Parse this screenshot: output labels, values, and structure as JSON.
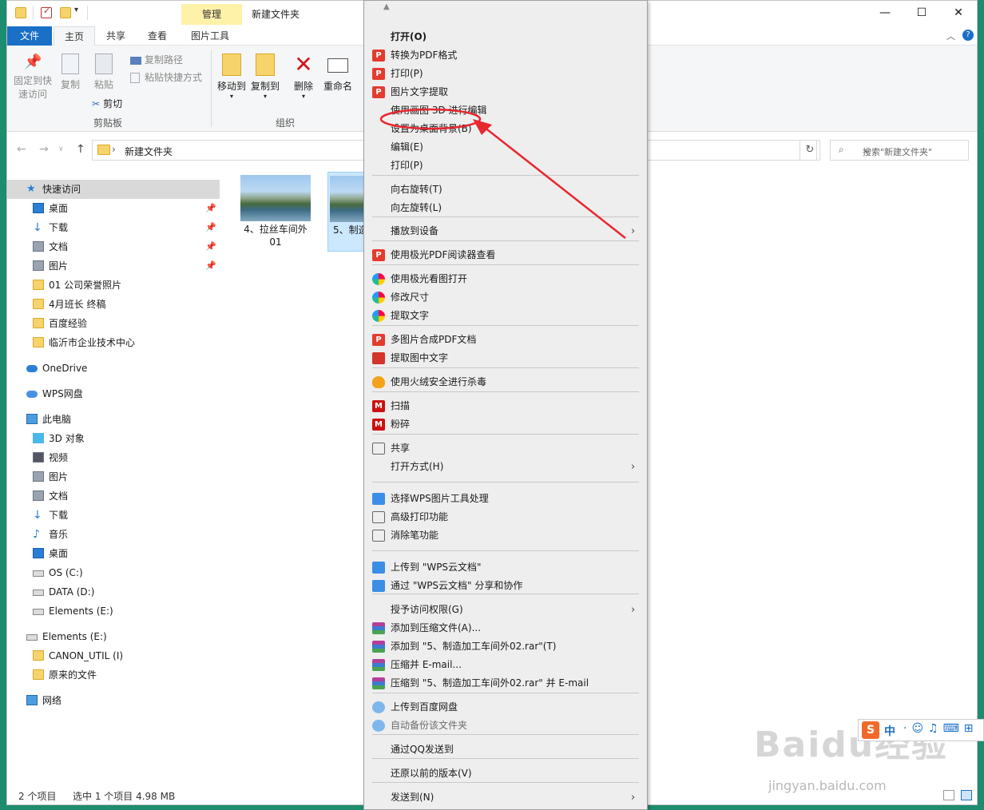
{
  "window": {
    "title": "新建文件夹",
    "contextual_tab": "管理",
    "controls": {
      "minimize": "—",
      "maximize": "☐",
      "close": "✕"
    }
  },
  "ribbon_tabs": [
    "文件",
    "主页",
    "共享",
    "查看",
    "图片工具"
  ],
  "ribbon": {
    "pin_quick": "固定到快速访问",
    "copy": "复制",
    "paste": "粘贴",
    "copy_path": "复制路径",
    "paste_shortcut": "粘贴快捷方式",
    "cut": "剪切",
    "group_clipboard": "剪贴板",
    "move_to": "移动到",
    "copy_to": "复制到",
    "delete": "删除",
    "rename": "重命名",
    "group_organize": "组织"
  },
  "address": {
    "path": "新建文件夹",
    "search_placeholder": "搜索\"新建文件夹\""
  },
  "nav": {
    "quick_access": "快速访问",
    "quick_items": [
      "桌面",
      "下载",
      "文档",
      "图片",
      "01 公司荣誉照片",
      "4月班长  终稿",
      "百度经验",
      "临沂市企业技术中心"
    ],
    "onedrive": "OneDrive",
    "wps_drive": "WPS网盘",
    "this_pc": "此电脑",
    "pc_items": [
      "3D 对象",
      "视频",
      "图片",
      "文档",
      "下载",
      "音乐",
      "桌面",
      "OS (C:)",
      "DATA (D:)",
      "Elements (E:)"
    ],
    "elements": "Elements (E:)",
    "elements_items": [
      "CANON_UTIL (I)",
      "原来的文件"
    ],
    "network": "网络"
  },
  "files": [
    {
      "caption_line1": "4、拉丝车间外",
      "caption_line2": "01"
    },
    {
      "caption_line1": "5、制造",
      "caption_line2": "外"
    }
  ],
  "status": {
    "count": "2 个项目",
    "selection": "选中 1 个项目  4.98 MB"
  },
  "context_menu": {
    "scroll_up": "▲",
    "items": [
      {
        "label": "打开(O)"
      },
      {
        "label": "转换为PDF格式"
      },
      {
        "label": "打印(P)"
      },
      {
        "label": "图片文字提取"
      },
      {
        "label": "使用画图 3D 进行编辑"
      },
      {
        "label": "设置为桌面背景(B)"
      },
      {
        "label": "编辑(E)"
      },
      {
        "label": "打印(P)"
      },
      {
        "label": "向右旋转(T)"
      },
      {
        "label": "向左旋转(L)"
      },
      {
        "label": "播放到设备"
      },
      {
        "label": "使用极光PDF阅读器查看"
      },
      {
        "label": "使用极光看图打开"
      },
      {
        "label": "修改尺寸"
      },
      {
        "label": "提取文字"
      },
      {
        "label": "多图片合成PDF文档"
      },
      {
        "label": "提取图中文字"
      },
      {
        "label": "使用火绒安全进行杀毒"
      },
      {
        "label": "扫描"
      },
      {
        "label": "粉碎"
      },
      {
        "label": "共享"
      },
      {
        "label": "打开方式(H)"
      },
      {
        "label": "选择WPS图片工具处理"
      },
      {
        "label": "高级打印功能"
      },
      {
        "label": "消除笔功能"
      },
      {
        "label": "上传到 \"WPS云文档\""
      },
      {
        "label": "通过 \"WPS云文档\" 分享和协作"
      },
      {
        "label": "授予访问权限(G)"
      },
      {
        "label": "添加到压缩文件(A)..."
      },
      {
        "label": "添加到 \"5、制造加工车间外02.rar\"(T)"
      },
      {
        "label": "压缩并 E-mail..."
      },
      {
        "label": "压缩到 \"5、制造加工车间外02.rar\" 并 E-mail"
      },
      {
        "label": "上传到百度网盘"
      },
      {
        "label": "自动备份该文件夹"
      },
      {
        "label": "通过QQ发送到"
      },
      {
        "label": "还原以前的版本(V)"
      },
      {
        "label": "发送到(N)"
      }
    ]
  },
  "ime": {
    "logo": "S",
    "mode": "中"
  },
  "watermark": {
    "logo": "Baidu经验",
    "url": "jingyan.baidu.com"
  },
  "colors": {
    "accent": "#1a6fc6",
    "annotation": "#e8262e",
    "desktop": "#1e8c6e"
  }
}
